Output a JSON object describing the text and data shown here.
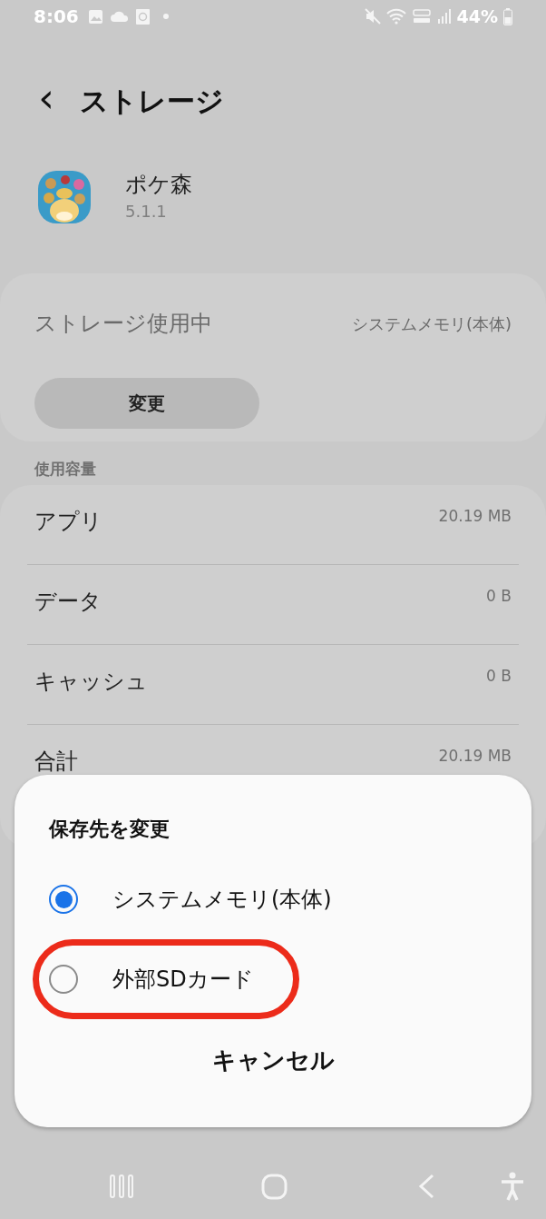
{
  "status_bar": {
    "time": "8:06",
    "battery": "44%"
  },
  "header": {
    "back": "‹",
    "title": "ストレージ"
  },
  "app": {
    "name": "ポケ森",
    "version": "5.1.1"
  },
  "storage_location": {
    "label": "ストレージ使用中",
    "value": "システムメモリ(本体)",
    "button": "変更"
  },
  "usage": {
    "heading": "使用容量",
    "rows": [
      {
        "label": "アプリ",
        "value": "20.19 MB"
      },
      {
        "label": "データ",
        "value": "0 B"
      },
      {
        "label": "キャッシュ",
        "value": "0 B"
      },
      {
        "label": "合計",
        "value": "20.19 MB"
      }
    ]
  },
  "dialog": {
    "title": "保存先を変更",
    "options": [
      {
        "label": "システムメモリ(本体)",
        "selected": true,
        "highlighted": false
      },
      {
        "label": "外部SDカード",
        "selected": false,
        "highlighted": true
      }
    ],
    "cancel": "キャンセル"
  }
}
